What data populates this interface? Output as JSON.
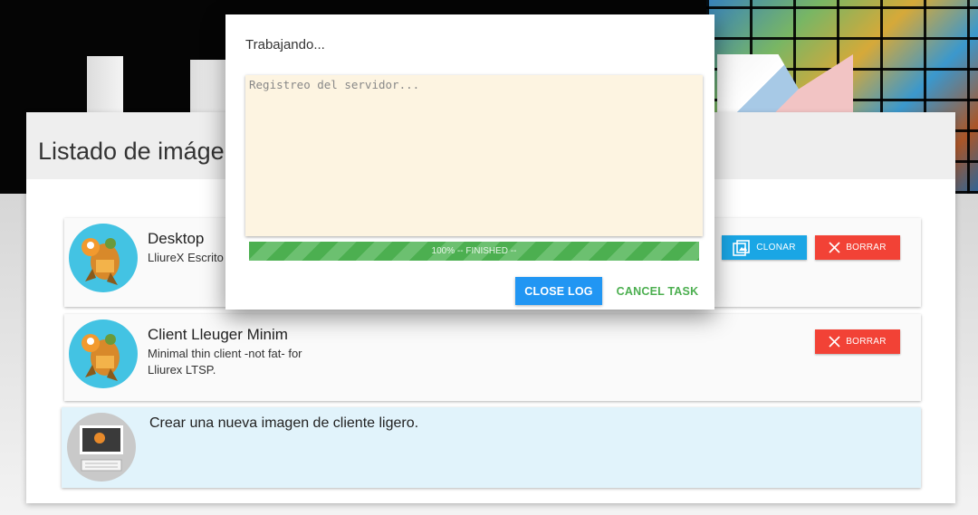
{
  "colors": {
    "header_bg": "#050505",
    "card_header_bg": "#eeeeee",
    "clone_button": "#1aa6e5",
    "delete_button": "#f24236",
    "new_item_bg": "#e1f3fb",
    "log_bg": "#fdf4e1",
    "progress": "#4caf50",
    "close_log_button": "#2196f3",
    "cancel_task_text": "#4caf50"
  },
  "page": {
    "title": "Listado de imáger"
  },
  "images": [
    {
      "title": "Desktop",
      "description": "LliureX Escrito",
      "avatar_icon": "lliurex-mascot-icon",
      "buttons": {
        "clone": "CLONAR",
        "delete": "BORRAR"
      }
    },
    {
      "title": "Client Lleuger Minim",
      "description": "Minimal thin client -not fat- for Lliurex LTSP.",
      "avatar_icon": "lliurex-mascot-icon",
      "buttons": {
        "delete": "BORRAR"
      }
    }
  ],
  "new_image": {
    "label": "Crear una nueva imagen de cliente ligero.",
    "icon": "thin-client-computer-icon"
  },
  "dialog": {
    "title": "Trabajando...",
    "log_placeholder": "Registreo del servidor...",
    "progress_percent": 100,
    "progress_text": "100% -- FINISHED --",
    "close_log": "CLOSE LOG",
    "cancel_task": "CANCEL TASK"
  }
}
